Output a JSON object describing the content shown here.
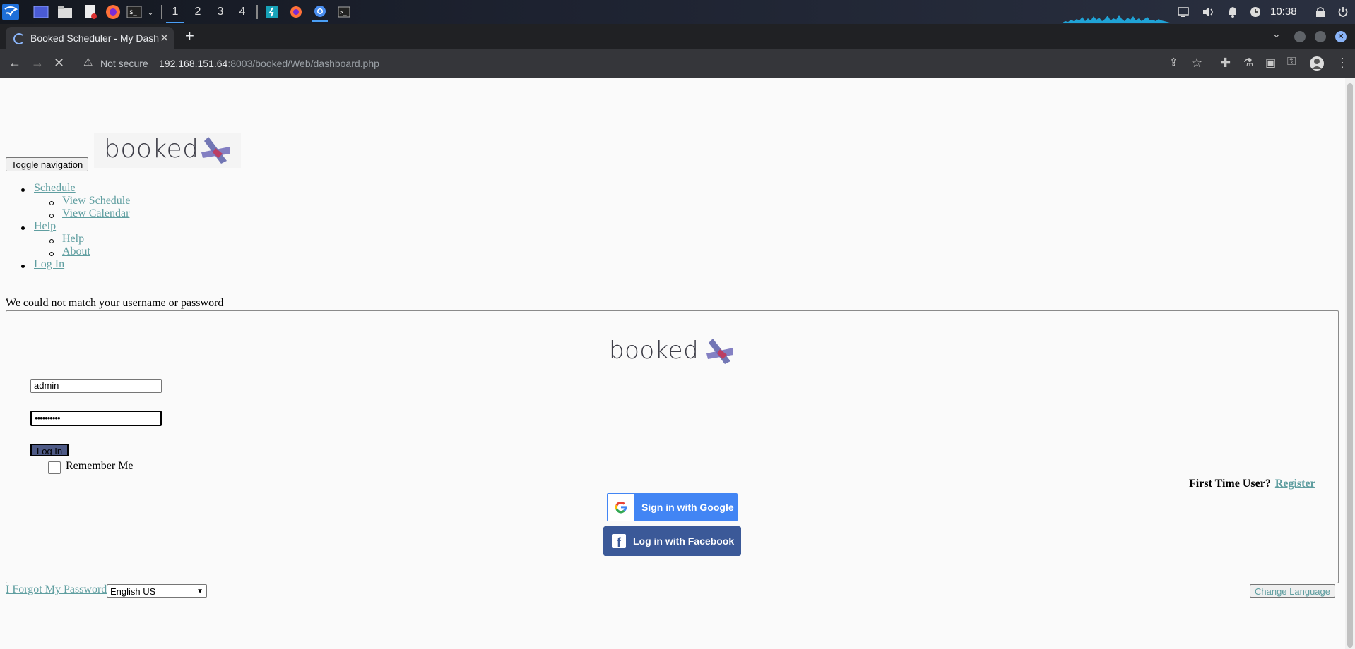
{
  "taskbar": {
    "workspaces": [
      "1",
      "2",
      "3",
      "4"
    ],
    "active_workspace": "1",
    "clock": "10:38",
    "icons": [
      "kali-menu-icon",
      "desktop-icon",
      "file-manager-icon",
      "text-editor-icon",
      "firefox-icon",
      "terminal-icon",
      "chevron-down-icon"
    ],
    "tray": [
      "screen-icon",
      "volume-icon",
      "bell-icon",
      "clock-icon",
      "lock-icon",
      "power-icon"
    ]
  },
  "browser": {
    "tab_title": "Booked Scheduler - My Dashboard",
    "new_tab": "+",
    "security_label": "Not secure",
    "url_host": "192.168.151.64",
    "url_path": ":8003/booked/Web/dashboard.php"
  },
  "page": {
    "toggle_navigation": "Toggle navigation",
    "logo_text": "booked",
    "nav": {
      "schedule": "Schedule",
      "view_schedule": "View Schedule",
      "view_calendar": "View Calendar",
      "help": "Help",
      "help_sub": "Help",
      "about": "About",
      "login": "Log In"
    },
    "error_message": "We could not match your username or password",
    "login": {
      "username_value": "admin",
      "password_mask": "••••••••••",
      "login_button": "Log In",
      "remember_me": "Remember Me",
      "first_time_user": "First Time User?",
      "register": "Register",
      "google_button": "Sign in with Google",
      "facebook_button": "Log in with Facebook"
    },
    "footer": {
      "forgot_password": "I Forgot My Password",
      "language_selected": "English US",
      "change_language": "Change Language"
    }
  },
  "colors": {
    "link": "#5f9ea0",
    "facebook": "#3b5998",
    "google": "#4285f4",
    "login_button": "#4e5a86"
  }
}
